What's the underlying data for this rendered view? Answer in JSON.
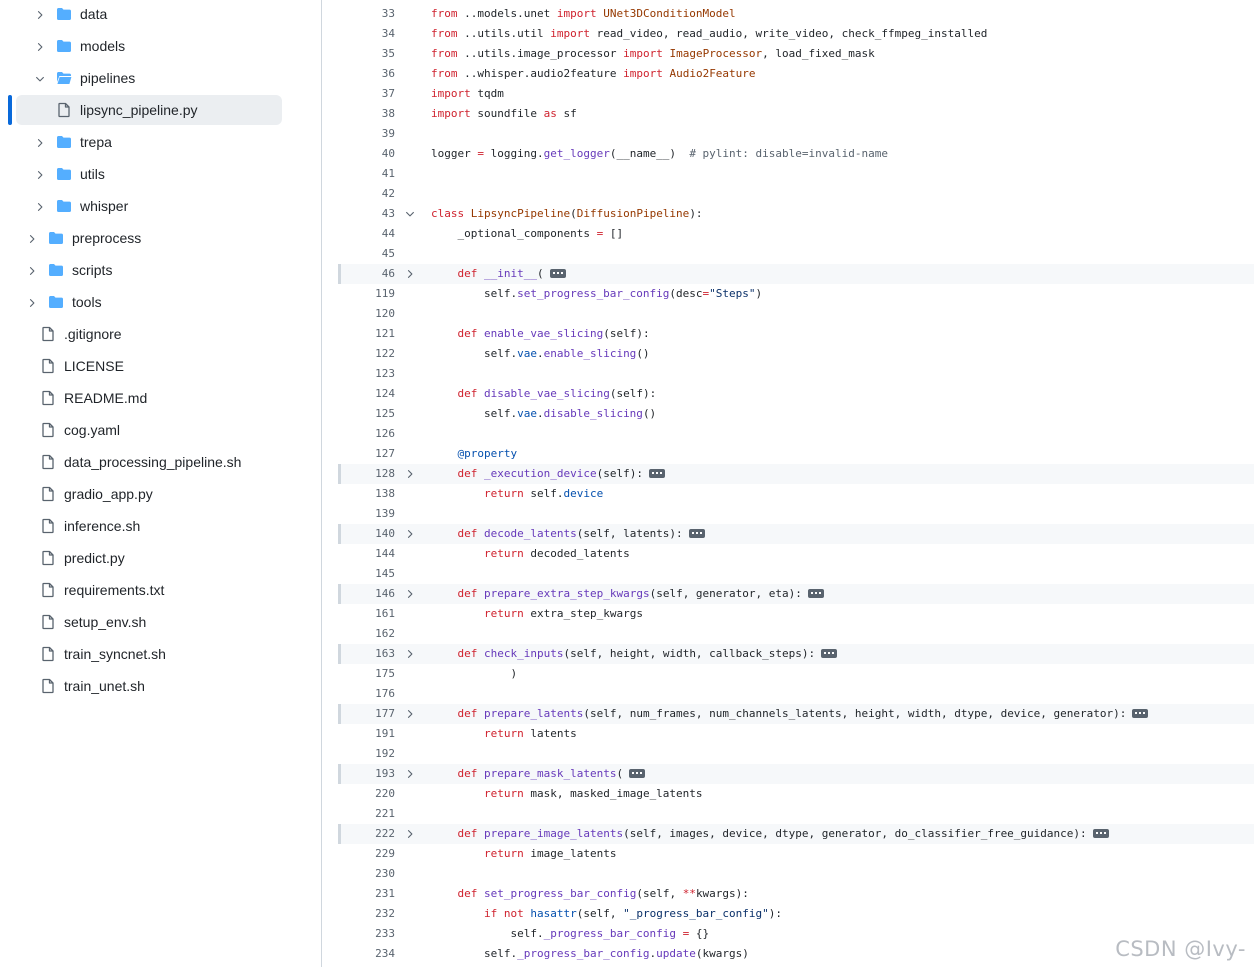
{
  "colors": {
    "folder": "#54aeff",
    "accent": "#0969da",
    "keyword": "#cf222e",
    "function": "#6639ba",
    "constant": "#0550ae",
    "string": "#0a3069",
    "entity": "#953800",
    "comment": "#59636e"
  },
  "file_tree": [
    {
      "label": "data",
      "type": "folder",
      "depth": 1,
      "expanded": false
    },
    {
      "label": "models",
      "type": "folder",
      "depth": 1,
      "expanded": false
    },
    {
      "label": "pipelines",
      "type": "folder",
      "depth": 1,
      "expanded": true
    },
    {
      "label": "lipsync_pipeline.py",
      "type": "file",
      "depth": 2,
      "selected": true
    },
    {
      "label": "trepa",
      "type": "folder",
      "depth": 1,
      "expanded": false
    },
    {
      "label": "utils",
      "type": "folder",
      "depth": 1,
      "expanded": false
    },
    {
      "label": "whisper",
      "type": "folder",
      "depth": 1,
      "expanded": false
    },
    {
      "label": "preprocess",
      "type": "folder",
      "depth": 0,
      "expanded": false
    },
    {
      "label": "scripts",
      "type": "folder",
      "depth": 0,
      "expanded": false
    },
    {
      "label": "tools",
      "type": "folder",
      "depth": 0,
      "expanded": false
    },
    {
      "label": ".gitignore",
      "type": "file",
      "depth": 0
    },
    {
      "label": "LICENSE",
      "type": "file",
      "depth": 0
    },
    {
      "label": "README.md",
      "type": "file",
      "depth": 0
    },
    {
      "label": "cog.yaml",
      "type": "file",
      "depth": 0
    },
    {
      "label": "data_processing_pipeline.sh",
      "type": "file",
      "depth": 0
    },
    {
      "label": "gradio_app.py",
      "type": "file",
      "depth": 0
    },
    {
      "label": "inference.sh",
      "type": "file",
      "depth": 0
    },
    {
      "label": "predict.py",
      "type": "file",
      "depth": 0
    },
    {
      "label": "requirements.txt",
      "type": "file",
      "depth": 0
    },
    {
      "label": "setup_env.sh",
      "type": "file",
      "depth": 0
    },
    {
      "label": "train_syncnet.sh",
      "type": "file",
      "depth": 0
    },
    {
      "label": "train_unet.sh",
      "type": "file",
      "depth": 0
    }
  ],
  "code_lines": [
    {
      "n": "33",
      "tokens": [
        [
          "k",
          "from"
        ],
        [
          "p",
          " ..models.unet "
        ],
        [
          "k",
          "import"
        ],
        [
          "p",
          " "
        ],
        [
          "e",
          "UNet3DConditionModel"
        ]
      ]
    },
    {
      "n": "34",
      "tokens": [
        [
          "k",
          "from"
        ],
        [
          "p",
          " ..utils.util "
        ],
        [
          "k",
          "import"
        ],
        [
          "p",
          " read_video, read_audio, write_video, check_ffmpeg_installed"
        ]
      ]
    },
    {
      "n": "35",
      "tokens": [
        [
          "k",
          "from"
        ],
        [
          "p",
          " ..utils.image_processor "
        ],
        [
          "k",
          "import"
        ],
        [
          "p",
          " "
        ],
        [
          "e",
          "ImageProcessor"
        ],
        [
          "p",
          ", load_fixed_mask"
        ]
      ]
    },
    {
      "n": "36",
      "tokens": [
        [
          "k",
          "from"
        ],
        [
          "p",
          " ..whisper.audio2feature "
        ],
        [
          "k",
          "import"
        ],
        [
          "p",
          " "
        ],
        [
          "e",
          "Audio2Feature"
        ]
      ]
    },
    {
      "n": "37",
      "tokens": [
        [
          "k",
          "import"
        ],
        [
          "p",
          " tqdm"
        ]
      ]
    },
    {
      "n": "38",
      "tokens": [
        [
          "k",
          "import"
        ],
        [
          "p",
          " soundfile "
        ],
        [
          "k",
          "as"
        ],
        [
          "p",
          " sf"
        ]
      ]
    },
    {
      "n": "39",
      "tokens": []
    },
    {
      "n": "40",
      "tokens": [
        [
          "p",
          "logger "
        ],
        [
          "k",
          "="
        ],
        [
          "p",
          " logging."
        ],
        [
          "f",
          "get_logger"
        ],
        [
          "p",
          "(__name__)  "
        ],
        [
          "cm",
          "# pylint: disable=invalid-name"
        ]
      ]
    },
    {
      "n": "41",
      "tokens": []
    },
    {
      "n": "42",
      "tokens": []
    },
    {
      "n": "43",
      "fold": "open",
      "tokens": [
        [
          "k",
          "class"
        ],
        [
          "p",
          " "
        ],
        [
          "e",
          "LipsyncPipeline"
        ],
        [
          "p",
          "("
        ],
        [
          "e",
          "DiffusionPipeline"
        ],
        [
          "p",
          "):"
        ]
      ]
    },
    {
      "n": "44",
      "tokens": [
        [
          "p",
          "    _optional_components "
        ],
        [
          "k",
          "="
        ],
        [
          "p",
          " []"
        ]
      ]
    },
    {
      "n": "45",
      "tokens": []
    },
    {
      "n": "46",
      "fold": "closed",
      "tokens": [
        [
          "p",
          "    "
        ],
        [
          "k",
          "def"
        ],
        [
          "p",
          " "
        ],
        [
          "f",
          "__init__"
        ],
        [
          "p",
          "("
        ]
      ]
    },
    {
      "n": "119",
      "tokens": [
        [
          "p",
          "        self."
        ],
        [
          "f",
          "set_progress_bar_config"
        ],
        [
          "p",
          "(desc"
        ],
        [
          "k",
          "="
        ],
        [
          "s",
          "\"Steps\""
        ],
        [
          "p",
          ")"
        ]
      ]
    },
    {
      "n": "120",
      "tokens": []
    },
    {
      "n": "121",
      "tokens": [
        [
          "p",
          "    "
        ],
        [
          "k",
          "def"
        ],
        [
          "p",
          " "
        ],
        [
          "f",
          "enable_vae_slicing"
        ],
        [
          "p",
          "(self):"
        ]
      ]
    },
    {
      "n": "122",
      "tokens": [
        [
          "p",
          "        self."
        ],
        [
          "c",
          "vae"
        ],
        [
          "p",
          "."
        ],
        [
          "f",
          "enable_slicing"
        ],
        [
          "p",
          "()"
        ]
      ]
    },
    {
      "n": "123",
      "tokens": []
    },
    {
      "n": "124",
      "tokens": [
        [
          "p",
          "    "
        ],
        [
          "k",
          "def"
        ],
        [
          "p",
          " "
        ],
        [
          "f",
          "disable_vae_slicing"
        ],
        [
          "p",
          "(self):"
        ]
      ]
    },
    {
      "n": "125",
      "tokens": [
        [
          "p",
          "        self."
        ],
        [
          "c",
          "vae"
        ],
        [
          "p",
          "."
        ],
        [
          "f",
          "disable_slicing"
        ],
        [
          "p",
          "()"
        ]
      ]
    },
    {
      "n": "126",
      "tokens": []
    },
    {
      "n": "127",
      "tokens": [
        [
          "p",
          "    "
        ],
        [
          "c",
          "@property"
        ]
      ]
    },
    {
      "n": "128",
      "fold": "closed",
      "tokens": [
        [
          "p",
          "    "
        ],
        [
          "k",
          "def"
        ],
        [
          "p",
          " "
        ],
        [
          "f",
          "_execution_device"
        ],
        [
          "p",
          "(self):"
        ]
      ]
    },
    {
      "n": "138",
      "tokens": [
        [
          "p",
          "        "
        ],
        [
          "k",
          "return"
        ],
        [
          "p",
          " self."
        ],
        [
          "c",
          "device"
        ]
      ]
    },
    {
      "n": "139",
      "tokens": []
    },
    {
      "n": "140",
      "fold": "closed",
      "tokens": [
        [
          "p",
          "    "
        ],
        [
          "k",
          "def"
        ],
        [
          "p",
          " "
        ],
        [
          "f",
          "decode_latents"
        ],
        [
          "p",
          "(self, latents):"
        ]
      ]
    },
    {
      "n": "144",
      "tokens": [
        [
          "p",
          "        "
        ],
        [
          "k",
          "return"
        ],
        [
          "p",
          " decoded_latents"
        ]
      ]
    },
    {
      "n": "145",
      "tokens": []
    },
    {
      "n": "146",
      "fold": "closed",
      "tokens": [
        [
          "p",
          "    "
        ],
        [
          "k",
          "def"
        ],
        [
          "p",
          " "
        ],
        [
          "f",
          "prepare_extra_step_kwargs"
        ],
        [
          "p",
          "(self, generator, eta):"
        ]
      ]
    },
    {
      "n": "161",
      "tokens": [
        [
          "p",
          "        "
        ],
        [
          "k",
          "return"
        ],
        [
          "p",
          " extra_step_kwargs"
        ]
      ]
    },
    {
      "n": "162",
      "tokens": []
    },
    {
      "n": "163",
      "fold": "closed",
      "tokens": [
        [
          "p",
          "    "
        ],
        [
          "k",
          "def"
        ],
        [
          "p",
          " "
        ],
        [
          "f",
          "check_inputs"
        ],
        [
          "p",
          "(self, height, width, callback_steps):"
        ]
      ]
    },
    {
      "n": "175",
      "tokens": [
        [
          "p",
          "            )"
        ]
      ]
    },
    {
      "n": "176",
      "tokens": []
    },
    {
      "n": "177",
      "fold": "closed",
      "tokens": [
        [
          "p",
          "    "
        ],
        [
          "k",
          "def"
        ],
        [
          "p",
          " "
        ],
        [
          "f",
          "prepare_latents"
        ],
        [
          "p",
          "(self, num_frames, num_channels_latents, height, width, dtype, device, generator):"
        ]
      ]
    },
    {
      "n": "191",
      "tokens": [
        [
          "p",
          "        "
        ],
        [
          "k",
          "return"
        ],
        [
          "p",
          " latents"
        ]
      ]
    },
    {
      "n": "192",
      "tokens": []
    },
    {
      "n": "193",
      "fold": "closed",
      "tokens": [
        [
          "p",
          "    "
        ],
        [
          "k",
          "def"
        ],
        [
          "p",
          " "
        ],
        [
          "f",
          "prepare_mask_latents"
        ],
        [
          "p",
          "("
        ]
      ]
    },
    {
      "n": "220",
      "tokens": [
        [
          "p",
          "        "
        ],
        [
          "k",
          "return"
        ],
        [
          "p",
          " mask, masked_image_latents"
        ]
      ]
    },
    {
      "n": "221",
      "tokens": []
    },
    {
      "n": "222",
      "fold": "closed",
      "tokens": [
        [
          "p",
          "    "
        ],
        [
          "k",
          "def"
        ],
        [
          "p",
          " "
        ],
        [
          "f",
          "prepare_image_latents"
        ],
        [
          "p",
          "(self, images, device, dtype, generator, do_classifier_free_guidance):"
        ]
      ]
    },
    {
      "n": "229",
      "tokens": [
        [
          "p",
          "        "
        ],
        [
          "k",
          "return"
        ],
        [
          "p",
          " image_latents"
        ]
      ]
    },
    {
      "n": "230",
      "tokens": []
    },
    {
      "n": "231",
      "tokens": [
        [
          "p",
          "    "
        ],
        [
          "k",
          "def"
        ],
        [
          "p",
          " "
        ],
        [
          "f",
          "set_progress_bar_config"
        ],
        [
          "p",
          "(self, "
        ],
        [
          "k",
          "**"
        ],
        [
          "p",
          "kwargs):"
        ]
      ]
    },
    {
      "n": "232",
      "tokens": [
        [
          "p",
          "        "
        ],
        [
          "k",
          "if"
        ],
        [
          "p",
          " "
        ],
        [
          "k",
          "not"
        ],
        [
          "p",
          " "
        ],
        [
          "c",
          "hasattr"
        ],
        [
          "p",
          "(self, "
        ],
        [
          "s",
          "\"_progress_bar_config\""
        ],
        [
          "p",
          "):"
        ]
      ]
    },
    {
      "n": "233",
      "tokens": [
        [
          "p",
          "            self."
        ],
        [
          "f",
          "_progress_bar_config"
        ],
        [
          "p",
          " "
        ],
        [
          "k",
          "="
        ],
        [
          "p",
          " {}"
        ]
      ]
    },
    {
      "n": "234",
      "tokens": [
        [
          "p",
          "        self."
        ],
        [
          "f",
          "_progress_bar_config"
        ],
        [
          "p",
          "."
        ],
        [
          "f",
          "update"
        ],
        [
          "p",
          "(kwargs)"
        ]
      ]
    }
  ],
  "watermark": "CSDN @Ivy-"
}
